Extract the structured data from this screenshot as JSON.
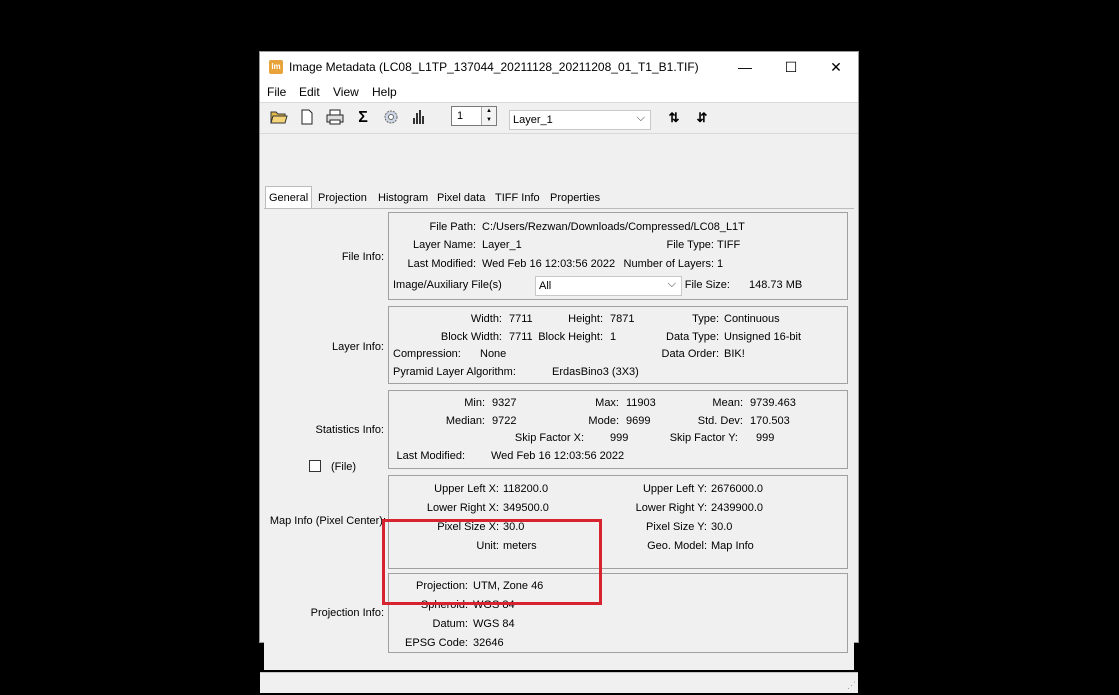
{
  "window": {
    "app_icon": "lm",
    "title": "Image Metadata (LC08_L1TP_137044_20211128_20211208_01_T1_B1.TIF)",
    "minimize": "—",
    "maximize": "☐",
    "close": "✕"
  },
  "menu": {
    "file": "File",
    "edit": "Edit",
    "view": "View",
    "help": "Help"
  },
  "toolbar": {
    "layer_number": "1",
    "layer_select": "Layer_1",
    "icons": [
      "open-folder-icon",
      "new-document-icon",
      "print-icon",
      "sigma-icon",
      "gear-icon",
      "histogram-icon",
      "sort-ascending-icon",
      "sort-descending-icon"
    ]
  },
  "tabs": [
    "General",
    "Projection",
    "Histogram",
    "Pixel data",
    "TIFF Info",
    "Properties"
  ],
  "file_info": {
    "label": "File Info:",
    "file_path_k": "File Path:",
    "file_path_v": "C:/Users/Rezwan/Downloads/Compressed/LC08_L1T",
    "layer_name_k": "Layer Name:",
    "layer_name_v": "Layer_1",
    "file_type_k": "File Type:",
    "file_type_v": "TIFF",
    "last_modified_k": "Last Modified:",
    "last_modified_v": "Wed Feb 16 12:03:56 2022",
    "num_layers_k": "Number of Layers:",
    "num_layers_v": "1",
    "aux_k": "Image/Auxiliary File(s)",
    "aux_v": "All",
    "file_size_k": "File Size:",
    "file_size_v": "148.73 MB"
  },
  "layer_info": {
    "label": "Layer Info:",
    "width_k": "Width:",
    "width_v": "7711",
    "height_k": "Height:",
    "height_v": "7871",
    "type_k": "Type:",
    "type_v": "Continuous",
    "bw_k": "Block Width:",
    "bw_v": "7711",
    "bh_k": "Block Height:",
    "bh_v": "1",
    "dtype_k": "Data Type:",
    "dtype_v": "Unsigned 16-bit",
    "comp_k": "Compression:",
    "comp_v": "None",
    "order_k": "Data Order:",
    "order_v": "BIK!",
    "pyr_k": "Pyramid Layer Algorithm:",
    "pyr_v": "ErdasBino3 (3X3)"
  },
  "stats_info": {
    "label": "Statistics Info:",
    "min_k": "Min:",
    "min_v": "9327",
    "max_k": "Max:",
    "max_v": "11903",
    "mean_k": "Mean:",
    "mean_v": "9739.463",
    "median_k": "Median:",
    "median_v": "9722",
    "mode_k": "Mode:",
    "mode_v": "9699",
    "std_k": "Std. Dev:",
    "std_v": "170.503",
    "skipx_k": "Skip Factor X:",
    "skipx_v": "999",
    "skipy_k": "Skip Factor Y:",
    "skipy_v": "999",
    "lm_k": "Last Modified:",
    "lm_v": "Wed Feb 16 12:03:56 2022",
    "file_check": "(File)"
  },
  "map_info": {
    "label": "Map Info (Pixel Center):",
    "ulx_k": "Upper Left X:",
    "ulx_v": "118200.0",
    "uly_k": "Upper Left Y:",
    "uly_v": "2676000.0",
    "lrx_k": "Lower Right X:",
    "lrx_v": "349500.0",
    "lry_k": "Lower Right Y:",
    "lry_v": "2439900.0",
    "psx_k": "Pixel Size X:",
    "psx_v": "30.0",
    "psy_k": "Pixel Size Y:",
    "psy_v": "30.0",
    "unit_k": "Unit:",
    "unit_v": "meters",
    "geo_k": "Geo. Model:",
    "geo_v": "Map Info"
  },
  "proj_info": {
    "label": "Projection Info:",
    "proj_k": "Projection:",
    "proj_v": "UTM, Zone 46",
    "sph_k": "Spheroid:",
    "sph_v": "WGS 84",
    "datum_k": "Datum:",
    "datum_v": "WGS 84",
    "epsg_k": "EPSG Code:",
    "epsg_v": "32646"
  },
  "colors": {
    "highlight": "#d7232f",
    "background": "#000000",
    "app_icon": "#e8a33a"
  }
}
